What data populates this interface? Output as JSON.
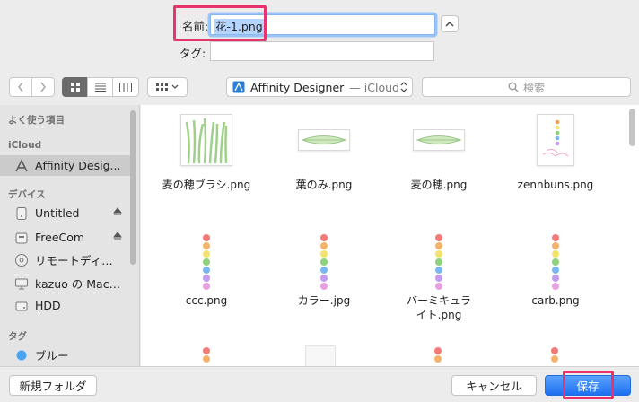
{
  "dialog": {
    "name_label": "名前:",
    "name_value": "花-1.png",
    "tag_label": "タグ:",
    "tag_value": ""
  },
  "toolbar": {
    "location": "Affinity Designer",
    "location_suffix": "— iCloud",
    "search_placeholder": "検索"
  },
  "sidebar": {
    "sections": [
      {
        "title": "よく使う項目"
      },
      {
        "title": "iCloud"
      },
      {
        "title": "デバイス"
      },
      {
        "title": "タグ"
      }
    ],
    "icloud_items": [
      {
        "label": "Affinity Desig...",
        "icon": "app-store-icon",
        "active": true
      }
    ],
    "devices": [
      {
        "label": "Untitled",
        "icon": "disk-icon",
        "eject": true
      },
      {
        "label": "FreeCom",
        "icon": "external-disk-icon",
        "eject": true
      },
      {
        "label": "リモートディ…",
        "icon": "optical-disc-icon",
        "eject": false
      },
      {
        "label": "kazuo の Mac…",
        "icon": "computer-icon",
        "eject": false
      },
      {
        "label": "HDD",
        "icon": "disk-icon",
        "eject": false
      }
    ],
    "tags": [
      {
        "label": "ブルー",
        "color": "#4aa3f0"
      }
    ]
  },
  "files": [
    {
      "name": "麦の穂ブラシ.png",
      "thumb": "grass"
    },
    {
      "name": "葉のみ.png",
      "thumb": "leaf"
    },
    {
      "name": "麦の穂.png",
      "thumb": "leaf"
    },
    {
      "name": "zennbuns.png",
      "thumb": "doc"
    },
    {
      "name": "ccc.png",
      "thumb": "dots"
    },
    {
      "name": "カラー.jpg",
      "thumb": "dots"
    },
    {
      "name": "バーミキュライト.png",
      "thumb": "dots"
    },
    {
      "name": "carb.png",
      "thumb": "dots"
    }
  ],
  "colors": {
    "accent": "#1d6ff2",
    "highlight_box": "#e8346b",
    "dot_colors": [
      "#f47a7a",
      "#f6b26b",
      "#f3e36a",
      "#8fd27b",
      "#79b8f2",
      "#c59af2",
      "#e7a0e0"
    ]
  },
  "buttons": {
    "new_folder": "新規フォルダ",
    "cancel": "キャンセル",
    "save": "保存"
  }
}
